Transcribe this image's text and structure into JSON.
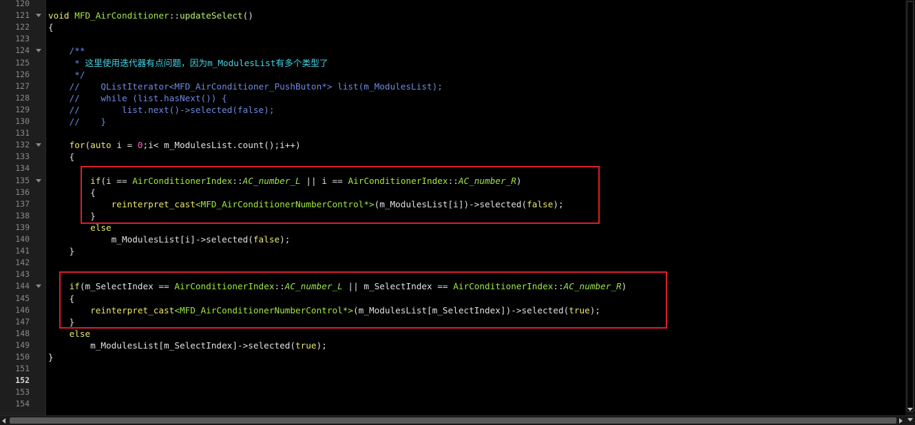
{
  "editor": {
    "current_line": "152",
    "colors": {
      "background": "#000000",
      "gutter": "#1e1e1e",
      "keyword": "#e8e86a",
      "type": "#a0e640",
      "comment": "#6e8ae0",
      "number": "#ff5fd0",
      "highlight_box": "#e01e2c"
    }
  },
  "lines": [
    {
      "n": "120",
      "fold": false,
      "segs": []
    },
    {
      "n": "121",
      "fold": true,
      "segs": [
        [
          "kw",
          "void"
        ],
        [
          "",
          " "
        ],
        [
          "type",
          "MFD_AirConditioner"
        ],
        [
          "",
          "::"
        ],
        [
          "fn",
          "updateSelect"
        ],
        [
          "",
          "()"
        ]
      ]
    },
    {
      "n": "122",
      "fold": false,
      "segs": [
        [
          "",
          "{"
        ]
      ]
    },
    {
      "n": "123",
      "fold": false,
      "segs": []
    },
    {
      "n": "124",
      "fold": true,
      "segs": [
        [
          "cm",
          "    /**"
        ]
      ]
    },
    {
      "n": "125",
      "fold": false,
      "segs": [
        [
          "cm",
          "     * "
        ],
        [
          "cmzh",
          "这里使用迭代器有点问题，因为m_ModulesList有多个类型了"
        ]
      ]
    },
    {
      "n": "126",
      "fold": false,
      "segs": [
        [
          "cm",
          "     */"
        ]
      ]
    },
    {
      "n": "127",
      "fold": false,
      "segs": [
        [
          "cm",
          "    //    QListIterator<MFD_AirConditioner_PushButon*> list(m_ModulesList);"
        ]
      ]
    },
    {
      "n": "128",
      "fold": false,
      "segs": [
        [
          "cm",
          "    //    while (list.hasNext()) {"
        ]
      ]
    },
    {
      "n": "129",
      "fold": false,
      "segs": [
        [
          "cm",
          "    //        list.next()->selected(false);"
        ]
      ]
    },
    {
      "n": "130",
      "fold": false,
      "segs": [
        [
          "cm",
          "    //    }"
        ]
      ]
    },
    {
      "n": "131",
      "fold": false,
      "segs": []
    },
    {
      "n": "132",
      "fold": true,
      "segs": [
        [
          "",
          "    "
        ],
        [
          "kw",
          "for"
        ],
        [
          "",
          "("
        ],
        [
          "kw",
          "auto"
        ],
        [
          "",
          " i = "
        ],
        [
          "num",
          "0"
        ],
        [
          "",
          ";i< m_ModulesList.count();i++)"
        ]
      ]
    },
    {
      "n": "133",
      "fold": false,
      "segs": [
        [
          "",
          "    {"
        ]
      ]
    },
    {
      "n": "134",
      "fold": false,
      "segs": []
    },
    {
      "n": "135",
      "fold": true,
      "segs": [
        [
          "",
          "        "
        ],
        [
          "kw",
          "if"
        ],
        [
          "",
          "(i == "
        ],
        [
          "type",
          "AirConditionerIndex"
        ],
        [
          "",
          "::"
        ],
        [
          "it",
          "AC_number_L"
        ],
        [
          "",
          " || i == "
        ],
        [
          "type",
          "AirConditionerIndex"
        ],
        [
          "",
          "::"
        ],
        [
          "it",
          "AC_number_R"
        ],
        [
          "",
          ")"
        ]
      ]
    },
    {
      "n": "136",
      "fold": false,
      "segs": [
        [
          "",
          "        {"
        ]
      ]
    },
    {
      "n": "137",
      "fold": false,
      "segs": [
        [
          "",
          "            "
        ],
        [
          "kw",
          "reinterpret_cast"
        ],
        [
          "tpl",
          "<MFD_AirConditionerNumberControl*>"
        ],
        [
          "",
          "(m_ModulesList[i])->selected("
        ],
        [
          "kw",
          "false"
        ],
        [
          "",
          ");"
        ]
      ]
    },
    {
      "n": "138",
      "fold": false,
      "segs": [
        [
          "",
          "        }"
        ]
      ]
    },
    {
      "n": "139",
      "fold": false,
      "segs": [
        [
          "",
          "        "
        ],
        [
          "kw",
          "else"
        ]
      ]
    },
    {
      "n": "140",
      "fold": false,
      "segs": [
        [
          "",
          "            m_ModulesList[i]->selected("
        ],
        [
          "kw",
          "false"
        ],
        [
          "",
          ");"
        ]
      ]
    },
    {
      "n": "141",
      "fold": false,
      "segs": [
        [
          "",
          "    }"
        ]
      ]
    },
    {
      "n": "142",
      "fold": false,
      "segs": []
    },
    {
      "n": "143",
      "fold": false,
      "segs": []
    },
    {
      "n": "144",
      "fold": true,
      "segs": [
        [
          "",
          "    "
        ],
        [
          "kw",
          "if"
        ],
        [
          "",
          "(m_SelectIndex == "
        ],
        [
          "type",
          "AirConditionerIndex"
        ],
        [
          "",
          "::"
        ],
        [
          "it",
          "AC_number_L"
        ],
        [
          "",
          " || m_SelectIndex == "
        ],
        [
          "type",
          "AirConditionerIndex"
        ],
        [
          "",
          "::"
        ],
        [
          "it",
          "AC_number_R"
        ],
        [
          "",
          ")"
        ]
      ]
    },
    {
      "n": "145",
      "fold": false,
      "segs": [
        [
          "",
          "    {"
        ]
      ]
    },
    {
      "n": "146",
      "fold": false,
      "segs": [
        [
          "",
          "        "
        ],
        [
          "kw",
          "reinterpret_cast"
        ],
        [
          "tpl",
          "<MFD_AirConditionerNumberControl*>"
        ],
        [
          "",
          "(m_ModulesList[m_SelectIndex])->selected("
        ],
        [
          "kw",
          "true"
        ],
        [
          "",
          ");"
        ]
      ]
    },
    {
      "n": "147",
      "fold": false,
      "segs": [
        [
          "",
          "    }"
        ]
      ]
    },
    {
      "n": "148",
      "fold": false,
      "segs": [
        [
          "",
          "    "
        ],
        [
          "kw",
          "else"
        ]
      ]
    },
    {
      "n": "149",
      "fold": false,
      "segs": [
        [
          "",
          "        m_ModulesList[m_SelectIndex]->selected("
        ],
        [
          "kw",
          "true"
        ],
        [
          "",
          ");"
        ]
      ]
    },
    {
      "n": "150",
      "fold": false,
      "segs": [
        [
          "",
          "}"
        ]
      ]
    },
    {
      "n": "151",
      "fold": false,
      "segs": []
    },
    {
      "n": "152",
      "fold": false,
      "segs": []
    },
    {
      "n": "153",
      "fold": false,
      "segs": []
    },
    {
      "n": "154",
      "fold": false,
      "segs": []
    }
  ]
}
